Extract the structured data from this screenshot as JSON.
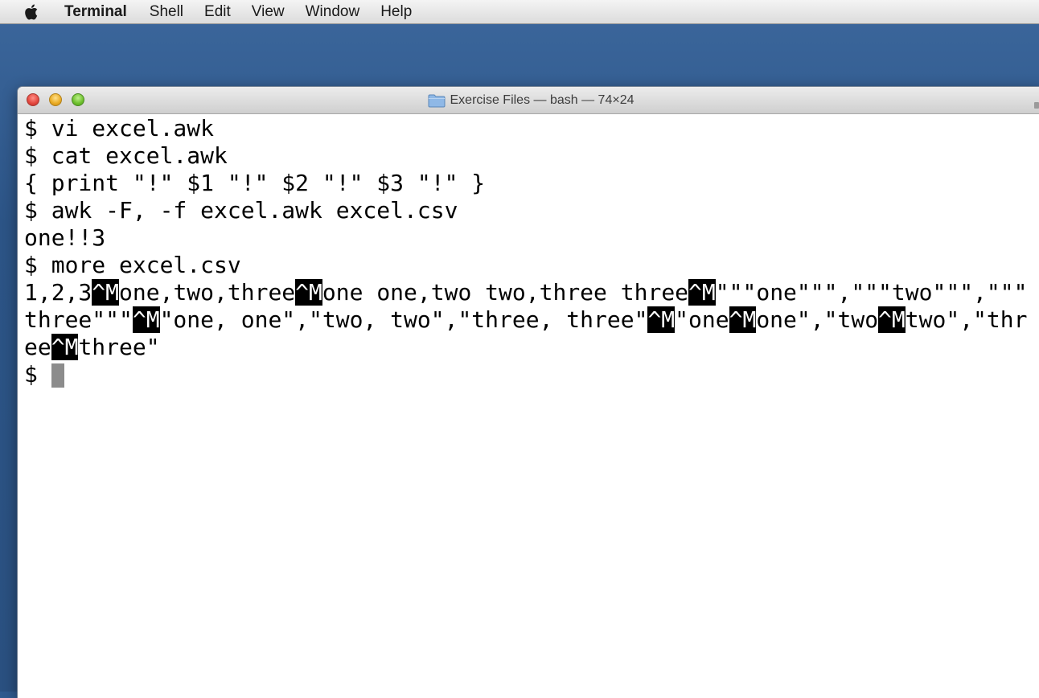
{
  "menubar": {
    "apple_icon": "apple-logo-icon",
    "app_name": "Terminal",
    "items": [
      "Shell",
      "Edit",
      "View",
      "Window",
      "Help"
    ]
  },
  "window": {
    "title": "Exercise Files — bash — 74×24",
    "folder_icon": "folder-icon"
  },
  "terminal": {
    "lines": [
      [
        {
          "t": "$ vi excel.awk"
        }
      ],
      [
        {
          "t": "$ cat excel.awk"
        }
      ],
      [
        {
          "t": "{ print \"!\" $1 \"!\" $2 \"!\" $3 \"!\" }"
        }
      ],
      [
        {
          "t": "$ awk -F, -f excel.awk excel.csv"
        }
      ],
      [
        {
          "t": "one!!3"
        }
      ],
      [
        {
          "t": "$ more excel.csv"
        }
      ],
      [
        {
          "t": "1,2,3"
        },
        {
          "c": "^M"
        },
        {
          "t": "one,two,three"
        },
        {
          "c": "^M"
        },
        {
          "t": "one one,two two,three three"
        },
        {
          "c": "^M"
        },
        {
          "t": "\"\"\"one\"\"\",\"\"\"two\"\"\",\"\"\""
        }
      ],
      [
        {
          "t": "three\"\"\""
        },
        {
          "c": "^M"
        },
        {
          "t": "\"one, one\",\"two, two\",\"three, three\""
        },
        {
          "c": "^M"
        },
        {
          "t": "\"one"
        },
        {
          "c": "^M"
        },
        {
          "t": "one\",\"two"
        },
        {
          "c": "^M"
        },
        {
          "t": "two\",\"thr"
        }
      ],
      [
        {
          "t": "ee"
        },
        {
          "c": "^M"
        },
        {
          "t": "three\""
        }
      ],
      [
        {
          "t": "$ "
        }
      ]
    ],
    "cursor": true
  }
}
